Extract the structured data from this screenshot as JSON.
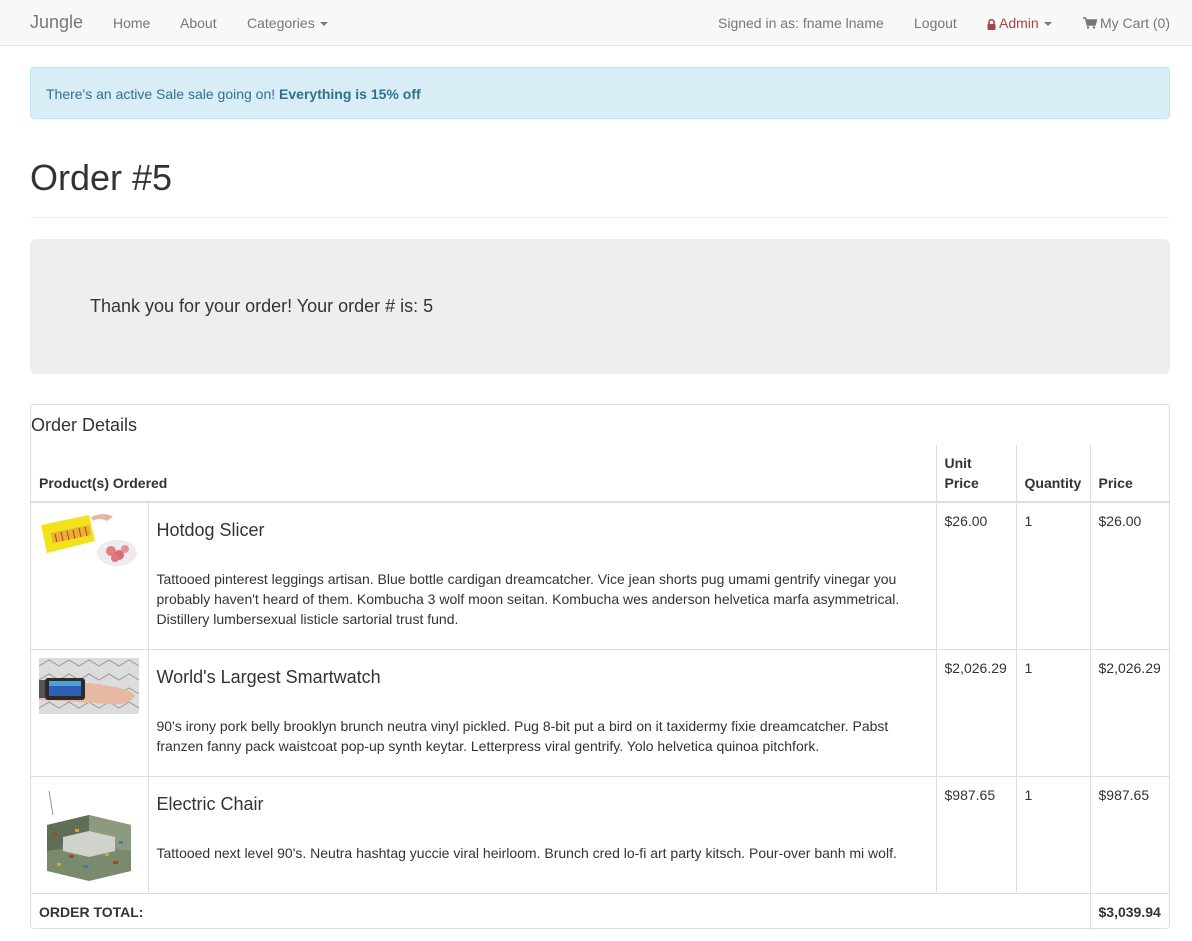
{
  "navbar": {
    "brand": "Jungle",
    "links": {
      "home": "Home",
      "about": "About",
      "categories": "Categories"
    },
    "signed_in": "Signed in as: fname lname",
    "logout": "Logout",
    "admin": "Admin",
    "cart": "My Cart (0)"
  },
  "alert": {
    "text": "There's an active Sale sale going on! ",
    "emphasis": "Everything is 15% off"
  },
  "page": {
    "title": "Order #5"
  },
  "jumbotron": {
    "message": "Thank you for your order! Your order # is: 5"
  },
  "order": {
    "heading": "Order Details",
    "columns": {
      "product": "Product(s) Ordered",
      "unit_price": "Unit Price",
      "quantity": "Quantity",
      "price": "Price"
    },
    "items": [
      {
        "name": "Hotdog Slicer",
        "description": "Tattooed pinterest leggings artisan. Blue bottle cardigan dreamcatcher. Vice jean shorts pug umami gentrify vinegar you probably haven't heard of them. Kombucha 3 wolf moon seitan. Kombucha wes anderson helvetica marfa asymmetrical. Distillery lumbersexual listicle sartorial trust fund.",
        "unit_price": "$26.00",
        "quantity": "1",
        "price": "$26.00"
      },
      {
        "name": "World's Largest Smartwatch",
        "description": "90's irony pork belly brooklyn brunch neutra vinyl pickled. Pug 8-bit put a bird on it taxidermy fixie dreamcatcher. Pabst franzen fanny pack waistcoat pop-up synth keytar. Letterpress viral gentrify. Yolo helvetica quinoa pitchfork.",
        "unit_price": "$2,026.29",
        "quantity": "1",
        "price": "$2,026.29"
      },
      {
        "name": "Electric Chair",
        "description": "Tattooed next level 90's. Neutra hashtag yuccie viral heirloom. Brunch cred lo-fi art party kitsch. Pour-over banh mi wolf.",
        "unit_price": "$987.65",
        "quantity": "1",
        "price": "$987.65"
      }
    ],
    "total_label": "ORDER TOTAL:",
    "total_value": "$3,039.94"
  },
  "colors": {
    "navbar_bg": "#f8f8f8",
    "alert_bg": "#d9edf7",
    "alert_text": "#31708f",
    "admin_text": "#a94442",
    "jumbotron_bg": "#eeeeee"
  }
}
